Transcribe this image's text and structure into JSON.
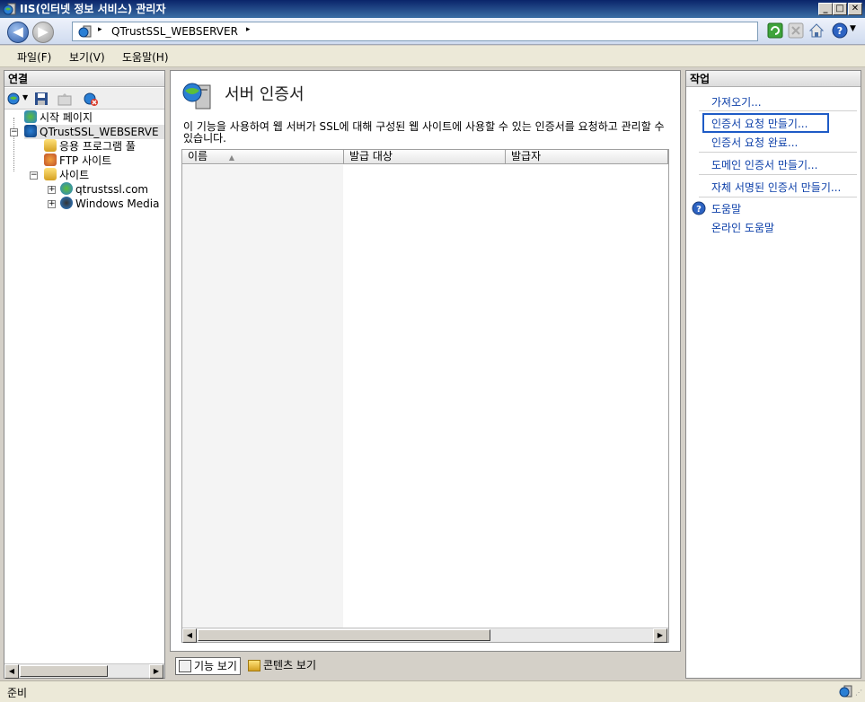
{
  "window": {
    "title": "IIS(인터넷 정보 서비스) 관리자",
    "buttons": [
      "_",
      "□",
      "✕"
    ]
  },
  "address": {
    "path_item": "QTrustSSL_WEBSERVER",
    "separator": "▸"
  },
  "menu": {
    "items": [
      "파일(F)",
      "보기(V)",
      "도움말(H)"
    ]
  },
  "connections": {
    "header": "연결",
    "tree": [
      {
        "label": "시작 페이지",
        "level": 1
      },
      {
        "label": "QTrustSSL_WEBSERVE",
        "level": 1
      },
      {
        "label": "응용 프로그램 풀",
        "level": 2
      },
      {
        "label": "FTP 사이트",
        "level": 2
      },
      {
        "label": "사이트",
        "level": 2
      },
      {
        "label": "qtrustssl.com",
        "level": 3
      },
      {
        "label": "Windows Media",
        "level": 3
      }
    ]
  },
  "feature": {
    "title": "서버 인증서",
    "description": "이 기능을 사용하여 웹 서버가 SSL에 대해 구성된 웹 사이트에 사용할 수 있는 인증서를 요청하고 관리할 수 있습니다.",
    "columns": [
      "이름",
      "발급 대상",
      "발급자"
    ],
    "sort_indicator": "▲"
  },
  "view_tabs": {
    "features": "기능 보기",
    "content": "콘텐츠 보기"
  },
  "actions": {
    "header": "작업",
    "import": "가져오기...",
    "create_request": "인증서 요청 만들기...",
    "complete_request": "인증서 요청 완료...",
    "create_domain": "도메인 인증서 만들기...",
    "create_selfsigned": "자체 서명된 인증서 만들기...",
    "help": "도움말",
    "online_help": "온라인 도움말"
  },
  "status": {
    "text": "준비"
  },
  "colors": {
    "accent": "#0b3ea8",
    "focus_box": "#1e5bc6",
    "titlebar": "#0a246a"
  }
}
